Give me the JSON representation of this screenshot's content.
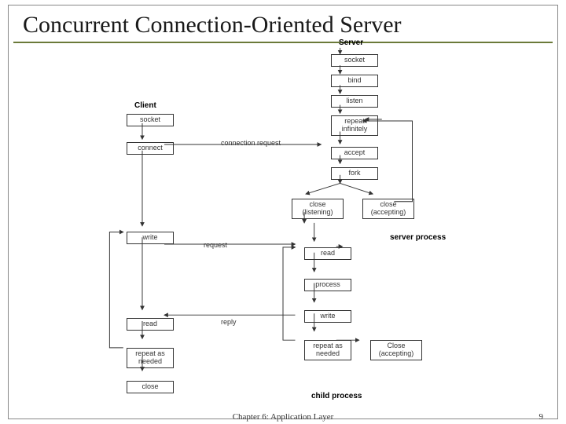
{
  "title": "Concurrent Connection-Oriented Server",
  "labels": {
    "server_header": "Server",
    "client_header": "Client",
    "server_process": "server process",
    "child_process": "child process"
  },
  "client_boxes": {
    "socket": "socket",
    "connect": "connect",
    "write": "write",
    "read": "read",
    "repeat": "repeat as\nneeded",
    "close": "close"
  },
  "server_boxes": {
    "socket": "socket",
    "bind": "bind",
    "listen": "listen",
    "repeat_inf": "repeat\ninfinitely",
    "accept": "accept",
    "fork": "fork",
    "close_listening": "close\n(listening)",
    "close_accepting": "close\n(accepting)",
    "read": "read",
    "process": "process",
    "write": "write",
    "repeat_needed": "repeat as\nneeded",
    "close_accepting2": "Close\n(accepting)"
  },
  "edge_labels": {
    "connection_request": "connection request",
    "request": "request",
    "reply": "reply"
  },
  "footer": {
    "chapter": "Chapter 6: Application Layer",
    "page": "9"
  }
}
